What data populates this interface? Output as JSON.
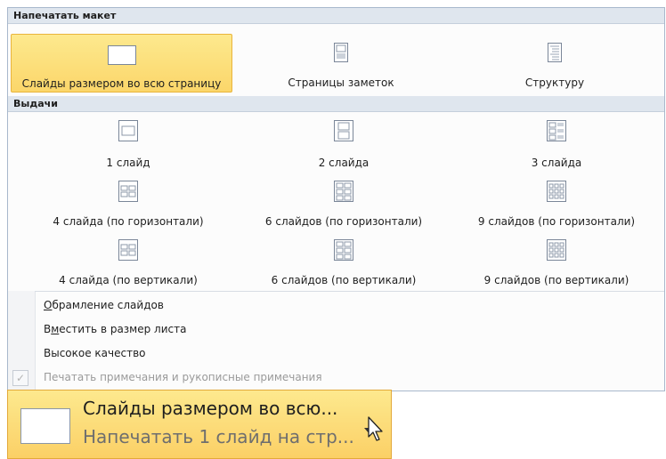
{
  "print_layout": {
    "header": "Напечатать макет",
    "items": [
      {
        "label": "Слайды размером во всю страницу",
        "icon": "full-page-slide-icon"
      },
      {
        "label": "Страницы заметок",
        "icon": "notes-page-icon"
      },
      {
        "label": "Структуру",
        "icon": "outline-icon"
      }
    ]
  },
  "handouts": {
    "header": "Выдачи",
    "items": [
      {
        "label": "1 слайд",
        "icon": "handout-1-icon"
      },
      {
        "label": "2 слайда",
        "icon": "handout-2-icon"
      },
      {
        "label": "3 слайда",
        "icon": "handout-3-icon"
      },
      {
        "label": "4 слайда (по горизонтали)",
        "icon": "handout-4h-icon"
      },
      {
        "label": "6 слайдов (по горизонтали)",
        "icon": "handout-6h-icon"
      },
      {
        "label": "9 слайдов (по горизонтали)",
        "icon": "handout-9h-icon"
      },
      {
        "label": "4 слайда (по вертикали)",
        "icon": "handout-4v-icon"
      },
      {
        "label": "6 слайдов (по вертикали)",
        "icon": "handout-6v-icon"
      },
      {
        "label": "9 слайдов (по вертикали)",
        "icon": "handout-9v-icon"
      }
    ]
  },
  "options": [
    {
      "label": "Обрамление слайдов",
      "access_key": "О"
    },
    {
      "label": "Вместить в размер листа",
      "access_key": "м"
    },
    {
      "label": "Высокое качество"
    },
    {
      "label": "Печатать примечания и рукописные примечания",
      "disabled": true,
      "checked": true
    }
  ],
  "selected_button": {
    "title": "Слайды размером во всю...",
    "subtitle": "Напечатать 1 слайд на стр..."
  },
  "colors": {
    "selected_bg": "#fbd66a",
    "header_bg": "#dfe6ee"
  }
}
